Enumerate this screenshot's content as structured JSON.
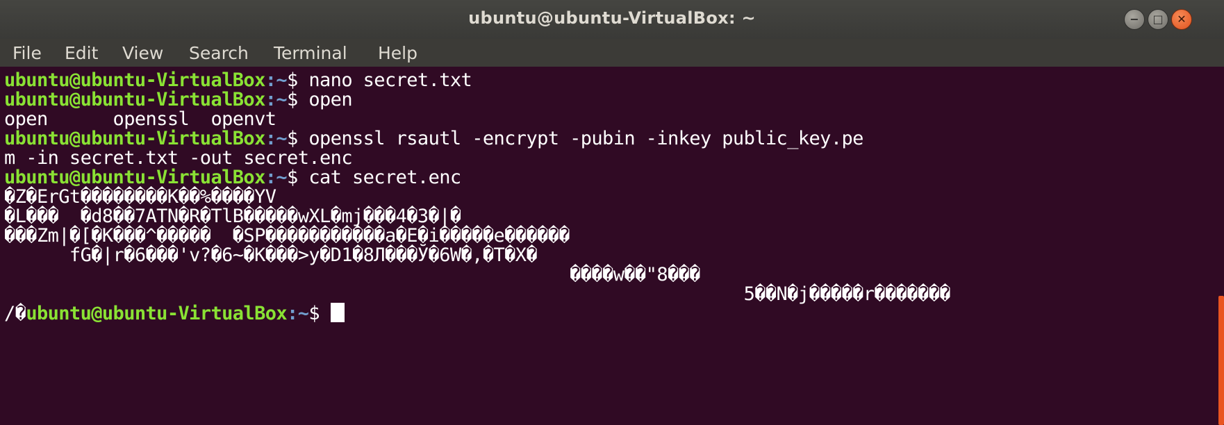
{
  "window": {
    "title": "ubuntu@ubuntu-VirtualBox: ~",
    "controls": {
      "minimize_icon": "−",
      "maximize_icon": "□",
      "close_icon": "✕"
    }
  },
  "menu": {
    "items": [
      "File",
      "Edit",
      "View",
      "Search",
      "Terminal",
      "Help"
    ]
  },
  "terminal": {
    "prompt_user": "ubuntu@ubuntu-VirtualBox",
    "prompt_path": ":~",
    "prompt_symbol": "$ ",
    "lines": [
      {
        "type": "prompt",
        "command": "nano secret.txt"
      },
      {
        "type": "prompt",
        "command": "open"
      },
      {
        "type": "output",
        "text": "open      openssl  openvt"
      },
      {
        "type": "prompt",
        "command": "openssl rsautl -encrypt -pubin -inkey public_key.pe"
      },
      {
        "type": "output",
        "text": "m -in secret.txt -out secret.enc"
      },
      {
        "type": "prompt",
        "command": "cat secret.enc"
      },
      {
        "type": "output",
        "text": "�Z�ErGt��������K��%����YV"
      },
      {
        "type": "output",
        "text": "�L���  �d8��7ATN�R�TlB�����wXL�mj���4�3�|�"
      },
      {
        "type": "output",
        "text": "���Zm|�[�K���^�����  �SP�����������a�E�i�����e������"
      },
      {
        "type": "output",
        "text": "      fG�|r�6���'v?�6~�K���>y�D1�8Л���Ў�6W�,�T�X�"
      },
      {
        "type": "output",
        "text": "                                                    ����w��\"8���"
      },
      {
        "type": "output",
        "text": "                                                                    5��N�j�����r�������"
      },
      {
        "type": "final-prompt",
        "prefix": "/�"
      }
    ]
  },
  "colors": {
    "background": "#300a24",
    "prompt_user": "#8ae234",
    "prompt_path": "#729fcf",
    "text": "#ffffff",
    "titlebar": "#3c3b37",
    "close_button": "#e95420"
  }
}
